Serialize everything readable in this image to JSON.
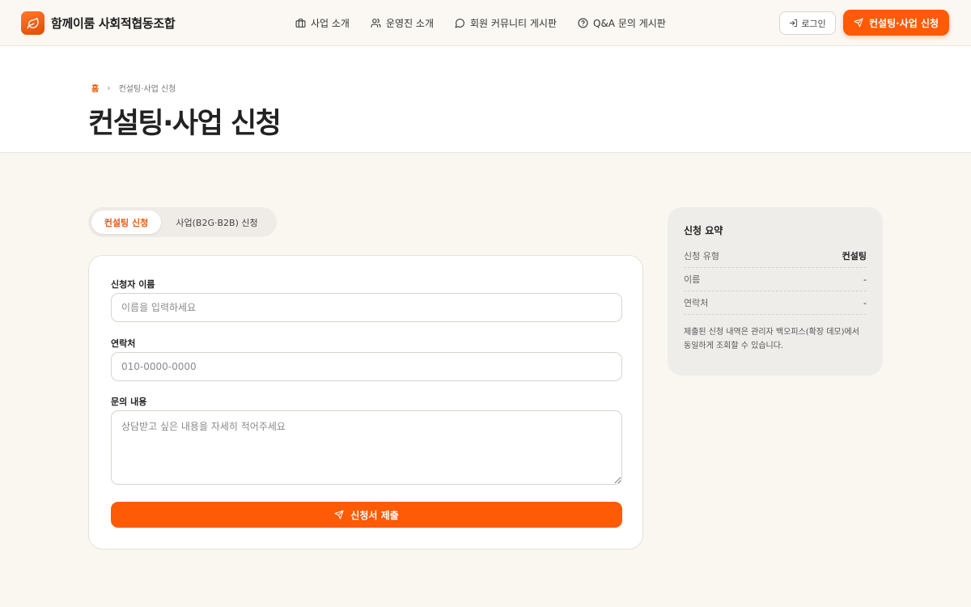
{
  "header": {
    "brand": "함께이룸 사회적협동조합",
    "nav": [
      {
        "label": "사업 소개",
        "icon": "briefcase-icon"
      },
      {
        "label": "운영진 소개",
        "icon": "users-icon"
      },
      {
        "label": "회원 커뮤니티 게시판",
        "icon": "message-circle-icon"
      },
      {
        "label": "Q&A 문의 게시판",
        "icon": "help-circle-icon"
      }
    ],
    "login_label": "로그인",
    "cta_label": "컨설팅·사업 신청"
  },
  "hero": {
    "breadcrumb_home": "홈",
    "breadcrumb_sep": "›",
    "breadcrumb_current": "컨설팅·사업 신청",
    "title": "컨설팅·사업 신청"
  },
  "tabs": [
    {
      "label": "컨설팅 신청",
      "active": true
    },
    {
      "label": "사업(B2G·B2B) 신청",
      "active": false
    }
  ],
  "form": {
    "name_label": "신청자 이름",
    "name_placeholder": "이름을 입력하세요",
    "name_value": "",
    "phone_label": "연락처",
    "phone_placeholder": "010-0000-0000",
    "phone_value": "",
    "message_label": "문의 내용",
    "message_placeholder": "상담받고 싶은 내용을 자세히 적어주세요",
    "submit_label": "신청서 제출"
  },
  "summary": {
    "title": "신청 요약",
    "rows": [
      {
        "key": "신청 유형",
        "value": "컨설팅"
      },
      {
        "key": "이름",
        "value": "-"
      },
      {
        "key": "연락처",
        "value": "-"
      }
    ],
    "note": "제출된 신청 내역은 관리자 백오피스(확장 데모)에서 동일하게 조회할 수 있습니다."
  },
  "colors": {
    "accent": "#ff5a05",
    "accent_text": "#e55a10",
    "page_bg": "#faf7f1",
    "summary_bg": "#efedea"
  }
}
